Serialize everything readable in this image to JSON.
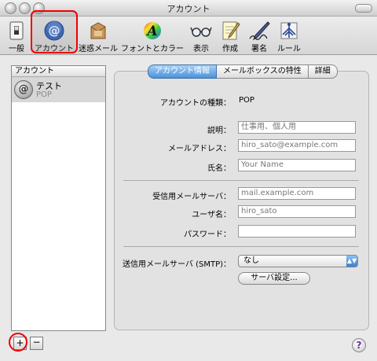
{
  "window": {
    "title": "アカウント"
  },
  "toolbar": {
    "items": [
      {
        "label": "一般",
        "icon": "light-switch-icon"
      },
      {
        "label": "アカウント",
        "icon": "at-sign-icon"
      },
      {
        "label": "迷惑メール",
        "icon": "junk-mail-icon"
      },
      {
        "label": "フォントとカラー",
        "icon": "font-color-icon"
      },
      {
        "label": "表示",
        "icon": "glasses-icon"
      },
      {
        "label": "作成",
        "icon": "compose-icon"
      },
      {
        "label": "署名",
        "icon": "signature-pen-icon"
      },
      {
        "label": "ルール",
        "icon": "rules-icon"
      }
    ]
  },
  "sidebar": {
    "header": "アカウント",
    "accounts": [
      {
        "name": "テスト",
        "type": "POP"
      }
    ],
    "add_label": "+",
    "remove_label": "−"
  },
  "tabs": [
    {
      "label": "アカウント情報",
      "active": true
    },
    {
      "label": "メールボックスの特性",
      "active": false
    },
    {
      "label": "詳細",
      "active": false
    }
  ],
  "form": {
    "account_type_label": "アカウントの種類：",
    "account_type_value": "POP",
    "description_label": "説明：",
    "description_placeholder": "仕事用、個人用",
    "email_label": "メールアドレス：",
    "email_placeholder": "hiro_sato@example.com",
    "fullname_label": "氏名：",
    "fullname_placeholder": "Your Name",
    "incoming_label": "受信用メールサーバ：",
    "incoming_placeholder": "mail.example.com",
    "username_label": "ユーザ名：",
    "username_placeholder": "hiro_sato",
    "password_label": "パスワード：",
    "password_value": "",
    "smtp_label": "送信用メールサーバ (SMTP)：",
    "smtp_value": "なし",
    "server_settings_button": "サーバ設定..."
  },
  "help": {
    "label": "?"
  },
  "colors": {
    "highlight_red": "#e00000",
    "accent_blue": "#4a92dc"
  }
}
